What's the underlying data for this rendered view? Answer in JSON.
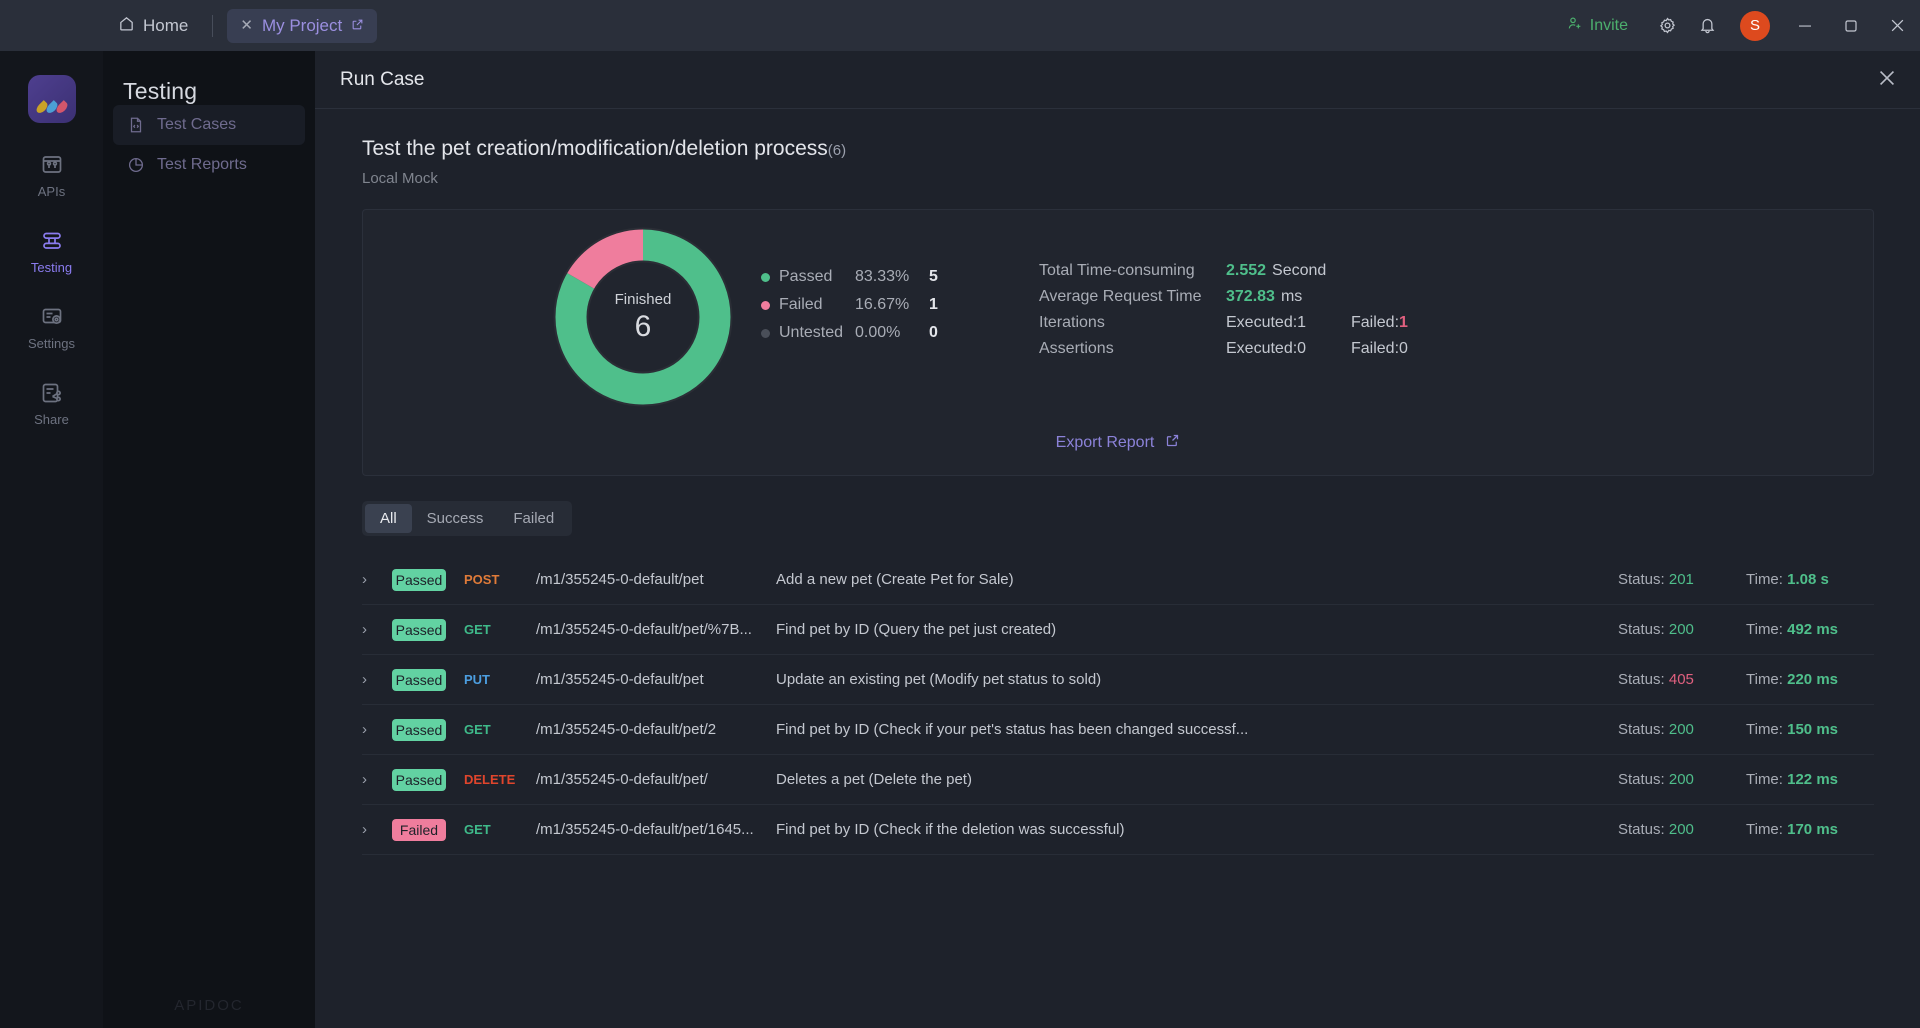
{
  "titlebar": {
    "home_label": "Home",
    "project_tab": "My Project",
    "invite_label": "Invite",
    "avatar_initial": "S",
    "gear_icon": "gear-icon",
    "bell_icon": "bell-icon",
    "minimize": "—",
    "maximize": "□",
    "close": "✕"
  },
  "rail": {
    "items": [
      {
        "label": "APIs",
        "icon": "apis-icon",
        "active": false
      },
      {
        "label": "Testing",
        "icon": "testing-icon",
        "active": true
      },
      {
        "label": "Settings",
        "icon": "settings-icon",
        "active": false
      },
      {
        "label": "Share",
        "icon": "share-icon",
        "active": false
      }
    ]
  },
  "sidebar": {
    "title": "Testing",
    "items": [
      {
        "label": "Test Cases",
        "icon": "file-code-icon",
        "selected": true
      },
      {
        "label": "Test Reports",
        "icon": "pie-chart-icon",
        "selected": false
      }
    ],
    "watermark": "APIDOC"
  },
  "main": {
    "panel_title": "Run Case",
    "close_icon": "close-icon",
    "case_title": "Test the pet creation/modification/deletion process",
    "case_count": "(6)",
    "case_sub": "Local Mock",
    "export_label": "Export Report",
    "export_icon": "external-link-icon"
  },
  "chart_data": {
    "type": "pie",
    "title": "Finished",
    "center_value": "6",
    "categories": [
      "Passed",
      "Failed",
      "Untested"
    ],
    "values": [
      5,
      1,
      0
    ],
    "percents": [
      "83.33%",
      "16.67%",
      "0.00%"
    ],
    "colors": [
      "#4fbf8b",
      "#ef7d9d",
      "#4a4f59"
    ],
    "legend_position": "right",
    "donut": true
  },
  "kpis": [
    {
      "label": "Total Time-consuming",
      "value": "2.552",
      "unit": "Second"
    },
    {
      "label": "Average Request Time",
      "value": "372.83",
      "unit": "ms"
    },
    {
      "label": "Iterations",
      "executed": "Executed:1",
      "failed_prefix": "Failed:",
      "failed": "1",
      "failed_is_error": true
    },
    {
      "label": "Assertions",
      "executed": "Executed:0",
      "failed_prefix": "Failed:",
      "failed": "0",
      "failed_is_error": false
    }
  ],
  "filters": {
    "tabs": [
      {
        "label": "All",
        "active": true
      },
      {
        "label": "Success",
        "active": false
      },
      {
        "label": "Failed",
        "active": false
      }
    ]
  },
  "results": {
    "rows": [
      {
        "chevron": "›",
        "status": "Passed",
        "status_type": "pass",
        "method": "POST",
        "path": "/m1/355245-0-default/pet",
        "desc": "Add a new pet (Create Pet for Sale)",
        "status_label": "Status:",
        "code": "201",
        "code_ok": true,
        "time_label": "Time:",
        "time": "1.08 s"
      },
      {
        "chevron": "›",
        "status": "Passed",
        "status_type": "pass",
        "method": "GET",
        "path": "/m1/355245-0-default/pet/%7B...",
        "desc": "Find pet by ID (Query the pet just created)",
        "status_label": "Status:",
        "code": "200",
        "code_ok": true,
        "time_label": "Time:",
        "time": "492 ms"
      },
      {
        "chevron": "›",
        "status": "Passed",
        "status_type": "pass",
        "method": "PUT",
        "path": "/m1/355245-0-default/pet",
        "desc": "Update an existing pet (Modify pet status to sold)",
        "status_label": "Status:",
        "code": "405",
        "code_ok": false,
        "time_label": "Time:",
        "time": "220 ms"
      },
      {
        "chevron": "›",
        "status": "Passed",
        "status_type": "pass",
        "method": "GET",
        "path": "/m1/355245-0-default/pet/2",
        "desc": "Find pet by ID (Check if your pet's status has been changed successf...",
        "status_label": "Status:",
        "code": "200",
        "code_ok": true,
        "time_label": "Time:",
        "time": "150 ms"
      },
      {
        "chevron": "›",
        "status": "Passed",
        "status_type": "pass",
        "method": "DELETE",
        "path": "/m1/355245-0-default/pet/",
        "desc": "Deletes a pet (Delete the pet)",
        "status_label": "Status:",
        "code": "200",
        "code_ok": true,
        "time_label": "Time:",
        "time": "122 ms"
      },
      {
        "chevron": "›",
        "status": "Failed",
        "status_type": "fail",
        "method": "GET",
        "path": "/m1/355245-0-default/pet/1645...",
        "desc": "Find pet by ID (Check if the deletion was successful)",
        "status_label": "Status:",
        "code": "200",
        "code_ok": true,
        "time_label": "Time:",
        "time": "170 ms"
      }
    ]
  }
}
